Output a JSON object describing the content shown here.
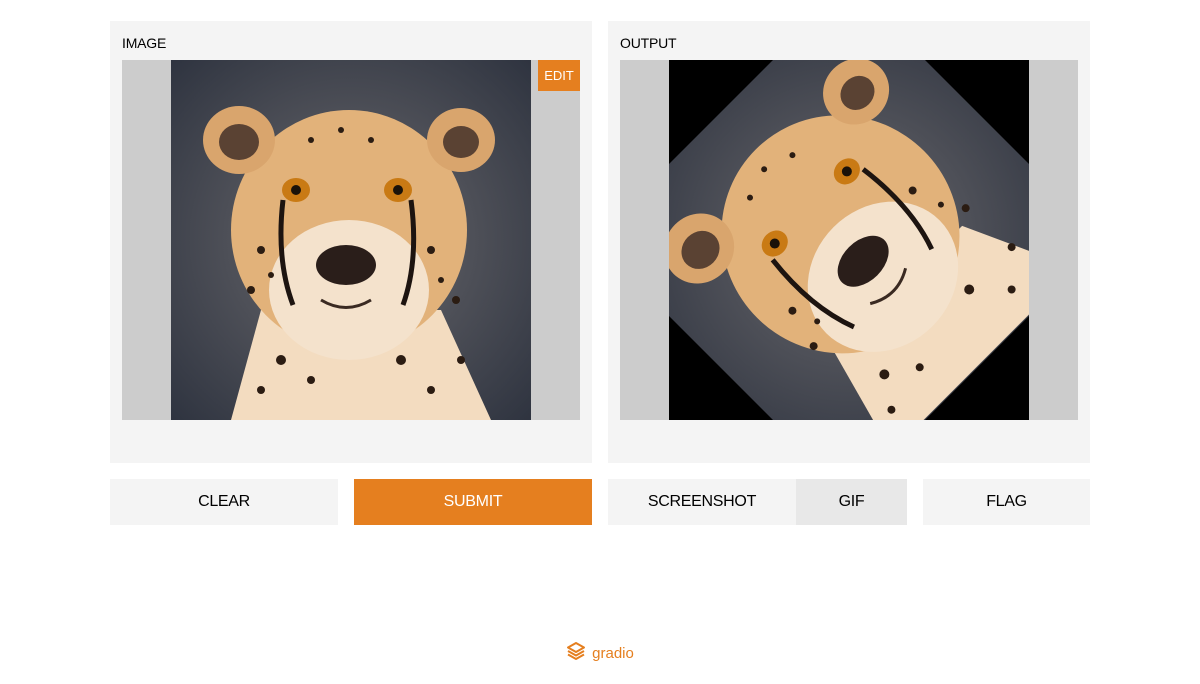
{
  "input_panel": {
    "label": "IMAGE",
    "edit_label": "EDIT",
    "image_subject": "cheetah face, upright"
  },
  "output_panel": {
    "label": "OUTPUT",
    "image_subject": "cheetah face rotated 45 degrees with black corners"
  },
  "buttons": {
    "clear": "CLEAR",
    "submit": "SUBMIT",
    "screenshot": "SCREENSHOT",
    "gif": "GIF",
    "flag": "FLAG"
  },
  "footer": {
    "brand": "gradio",
    "logo_icon": "gradio-logo-icon"
  },
  "colors": {
    "accent": "#e57f1f",
    "panel_bg": "#f4f4f4",
    "image_letterbox": "#cccccc"
  }
}
